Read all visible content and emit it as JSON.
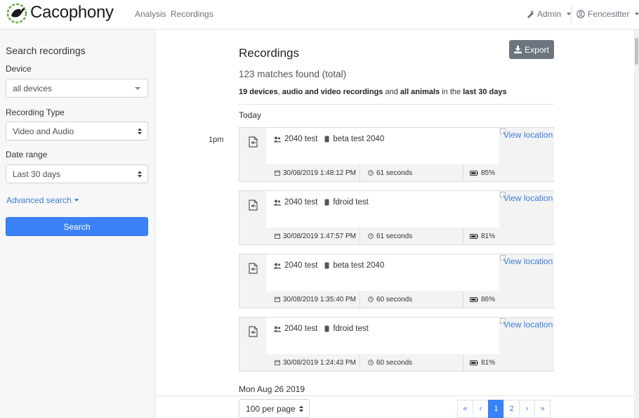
{
  "header": {
    "brand": "Cacophony",
    "nav": [
      "Analysis",
      "Recordings"
    ],
    "admin_label": "Admin",
    "user_label": "Fencesitter"
  },
  "sidebar": {
    "title": "Search recordings",
    "device_label": "Device",
    "device_value": "all devices",
    "type_label": "Recording Type",
    "type_value": "Video and Audio",
    "date_label": "Date range",
    "date_value": "Last 30 days",
    "advanced_label": "Advanced search",
    "search_label": "Search"
  },
  "main": {
    "title": "Recordings",
    "export_label": "Export",
    "matches": "123 matches found (total)",
    "summary": {
      "devices": "19 devices",
      "sep1": ", ",
      "types": "audio and video recordings",
      "and": " and ",
      "animals": "all animals",
      "in_the": " in the ",
      "range": "last 30 days"
    },
    "today_label": "Today",
    "time_label": "1pm",
    "next_day_label": "Mon Aug 26 2019"
  },
  "recordings": [
    {
      "group": "2040 test",
      "device": "beta test 2040",
      "datetime": "30/08/2019 1:48:12 PM",
      "duration": "61 seconds",
      "battery": "85%",
      "location": "View location"
    },
    {
      "group": "2040 test",
      "device": "fdroid test",
      "datetime": "30/08/2019 1:47:57 PM",
      "duration": "61 seconds",
      "battery": "81%",
      "location": "View location"
    },
    {
      "group": "2040 test",
      "device": "beta test 2040",
      "datetime": "30/08/2019 1:35:40 PM",
      "duration": "60 seconds",
      "battery": "86%",
      "location": "View location"
    },
    {
      "group": "2040 test",
      "device": "fdroid test",
      "datetime": "30/08/2019 1:24:43 PM",
      "duration": "60 seconds",
      "battery": "81%",
      "location": "View location"
    }
  ],
  "footer": {
    "per_page": "100 per page",
    "pages": [
      "«",
      "‹",
      "1",
      "2",
      "›",
      "»"
    ],
    "active_page": "1"
  },
  "colors": {
    "primary": "#3b82f6",
    "link": "#3b7ddd",
    "secondary": "#6c757d"
  }
}
